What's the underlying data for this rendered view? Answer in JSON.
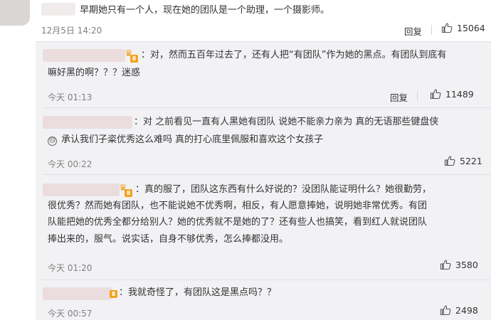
{
  "top_comment": {
    "text": "早期她只有一个人，现在她的团队是一个助理，一个摄影师。",
    "time": "12月5日 14:20",
    "reply_label": "回复",
    "likes": "15064"
  },
  "replies": [
    {
      "line1": "：对，然而五百年过去了，还有人把“有团队”作为她的黑点。有团队到底有",
      "line2": "嘛好黑的啊？？？迷惑",
      "time": "今天 01:13",
      "reply_label": "回复",
      "likes": "11489"
    },
    {
      "line1": "：对  之前看见一直有人黑她有团队 说她不能亲力亲为  真的无语那些键盘侠",
      "line2": "承认我们子粢优秀这么难吗  真的打心底里佩服和喜欢这个女孩子",
      "time": "今天 00:22",
      "likes": "5221"
    },
    {
      "line1": "：真的服了，团队这东西有什么好说的？没团队能证明什么？她很勤劳，",
      "line2": "很优秀？然而她有团队，也不能说她不优秀啊，相反，有人愿意捧她，说明她非常优秀。有团",
      "line3": "队能把她的优秀全都分给别人？她的优秀就不是她的了？还有些人也搞笑，看到红人就说团队",
      "line4": "捧出来的，服气。说实话，自身不够优秀，怎么捧都没用。",
      "time": "今天 01:20",
      "likes": "3580"
    },
    {
      "line1": "：我就奇怪了，有团队这是黑点吗？？",
      "time": "今天 00:57",
      "likes": "2498"
    }
  ],
  "icons": {
    "like": "thumbs-up-icon",
    "crown": "crown-icon",
    "badge": "level-badge-icon",
    "emoji": "sad-face-icon"
  },
  "colors": {
    "reply_bg": "#f2f2f5",
    "badge": "#f4a21a"
  }
}
